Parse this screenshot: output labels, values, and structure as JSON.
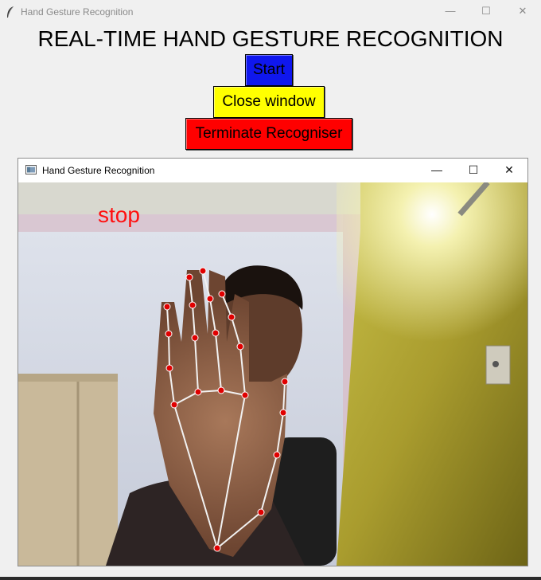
{
  "window": {
    "title": "Hand Gesture Recognition",
    "minimize_glyph": "—",
    "maximize_glyph": "☐",
    "close_glyph": "✕"
  },
  "header": {
    "title": "REAL-TIME HAND GESTURE RECOGNITION"
  },
  "controls": {
    "start_label": "Start",
    "close_window_label": "Close window",
    "terminate_label": "Terminate Recogniser"
  },
  "colors": {
    "start_bg": "#0f17ee",
    "close_bg": "#ffff00",
    "terminate_bg": "#ff0000",
    "gesture_text": "#ff1010",
    "landmark": "#e00000",
    "connection": "#f2f2f2"
  },
  "camera_window": {
    "title": "Hand Gesture Recognition",
    "minimize_glyph": "—",
    "maximize_glyph": "☐",
    "close_glyph": "✕",
    "gesture_label": "stop"
  }
}
